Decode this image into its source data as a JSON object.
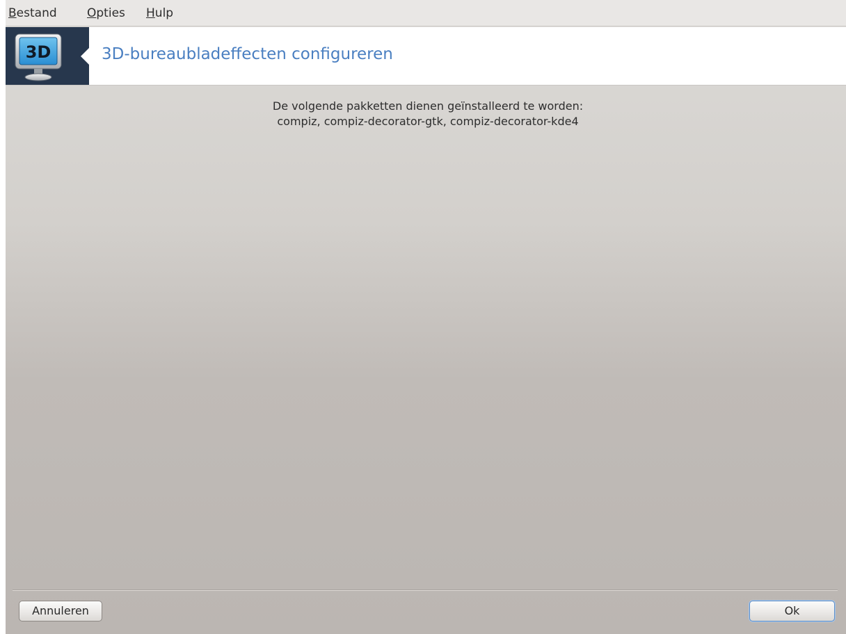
{
  "menubar": {
    "items": [
      {
        "mnemonic": "B",
        "rest": "estand"
      },
      {
        "mnemonic": "O",
        "rest": "pties"
      },
      {
        "mnemonic": "H",
        "rest": "ulp"
      }
    ]
  },
  "header": {
    "icon_text": "3D",
    "title": "3D-bureaubladeffecten configureren"
  },
  "message": {
    "line1": "De volgende pakketten dienen geïnstalleerd te worden:",
    "line2": "compiz, compiz-decorator-gtk, compiz-decorator-kde4"
  },
  "buttons": {
    "cancel_label": "Annuleren",
    "ok_label": "Ok"
  },
  "colors": {
    "title": "#4a7fc1",
    "banner": "#27374d",
    "ok_border": "#5d8fc9"
  }
}
